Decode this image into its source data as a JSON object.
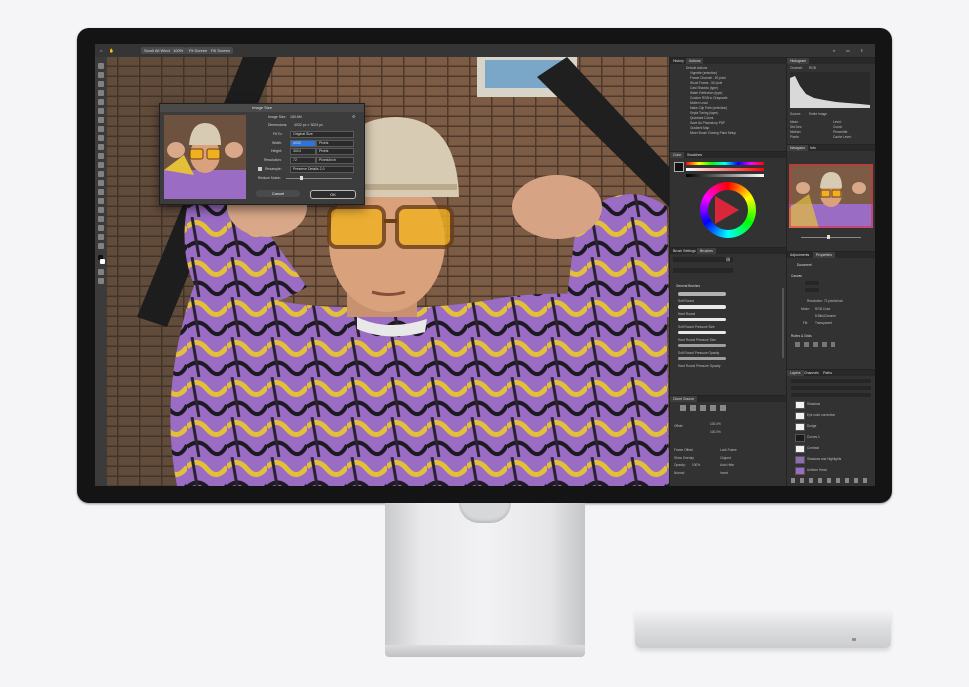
{
  "app": {
    "options_bar": [
      "Scroll All Windows",
      "100%",
      "Fit Screen",
      "Fill Screen"
    ]
  },
  "dialog": {
    "title": "Image Size",
    "image_size_label": "Image Size:",
    "image_size_value": "183.6M",
    "dimensions_label": "Dimensions:",
    "dimensions_value": "4032 px × 3024 px",
    "fit_to_label": "Fit To:",
    "fit_to_value": "Original Size",
    "width_label": "Width:",
    "width_value": "4032",
    "width_unit": "Pixels",
    "height_label": "Height:",
    "height_value": "3024",
    "height_unit": "Pixels",
    "resolution_label": "Resolution:",
    "resolution_value": "72",
    "resolution_unit": "Pixels/Inch",
    "resample_label": "Resample:",
    "resample_value": "Preserve Details 2.0",
    "reduce_noise_label": "Reduce Noise:",
    "cancel_label": "Cancel",
    "ok_label": "OK"
  },
  "actions_panel": {
    "tabs": [
      "History",
      "Actions"
    ],
    "items": [
      "Default Actions",
      "Vignette (selection)",
      "Frame Channel - 50 pixel",
      "Wood Frame - 50 pixel",
      "Cast Shadow (type)",
      "Water Reflection (type)",
      "Custom RGB to Grayscale",
      "Molten Lead",
      "Make Clip Path (selection)",
      "Sepia Toning (layer)",
      "Quadrant Colors",
      "Save As Photoshop PDF",
      "Gradient Map",
      "Mixer Brush Cloning Paint Setup"
    ]
  },
  "histogram_panel": {
    "tabs": [
      "Histogram"
    ],
    "channel_label": "Channel:",
    "channel_value": "RGB",
    "source_label": "Source:",
    "source_value": "Entire Image",
    "stats": [
      "Mean:",
      "Std Dev:",
      "Median:",
      "Pixels:",
      "Level:",
      "Count:",
      "Percentile:",
      "Cache Level:"
    ]
  },
  "navigator_panel": {
    "tabs": [
      "Navigator",
      "Info"
    ]
  },
  "color_panel": {
    "tabs": [
      "Color",
      "Swatches"
    ]
  },
  "brushes_panel": {
    "tabs": [
      "Brush Settings",
      "Brushes"
    ],
    "group": "General Brushes",
    "items": [
      "Soft Round",
      "Hard Round",
      "Soft Round Pressure Size",
      "Hard Round Pressure Size",
      "Soft Round Pressure Opacity",
      "Hard Round Pressure Opacity"
    ]
  },
  "clone_panel": {
    "tabs": [
      "Clone Source"
    ],
    "offset_label": "Offset:",
    "w_value": "100.0%",
    "h_value": "100.0%",
    "frame_offset_label": "Frame Offset:",
    "lock_frame_label": "Lock Frame",
    "show_overlay_label": "Show Overlay",
    "clipped_label": "Clipped",
    "opacity_label": "Opacity:",
    "opacity_value": "100%",
    "auto_hide_label": "Auto Hide",
    "invert_label": "Invert",
    "normal_value": "Normal"
  },
  "properties_panel": {
    "tabs": [
      "Adjustments",
      "Properties"
    ],
    "heading": "Document",
    "canvas_label": "Canvas",
    "resolution_label": "Resolution: 72 pixels/inch",
    "mode_label": "Mode:",
    "mode_value": "RGB Color",
    "bit_depth": "8 Bits/Channel",
    "fill_label": "Fill:",
    "fill_value": "Transparent",
    "rulers_label": "Rulers & Grids"
  },
  "layers_panel": {
    "tabs": [
      "Layers",
      "Channels",
      "Paths"
    ],
    "layers": [
      "Shadows",
      "Eye color correction",
      "Dodge",
      "Curves 1",
      "Contrast",
      "Shadows and Highlights",
      "Uniform Head"
    ]
  },
  "colors": {
    "panel_bg": "#323232",
    "accent": "#2c74e0",
    "monitor_bezel": "#141414"
  }
}
